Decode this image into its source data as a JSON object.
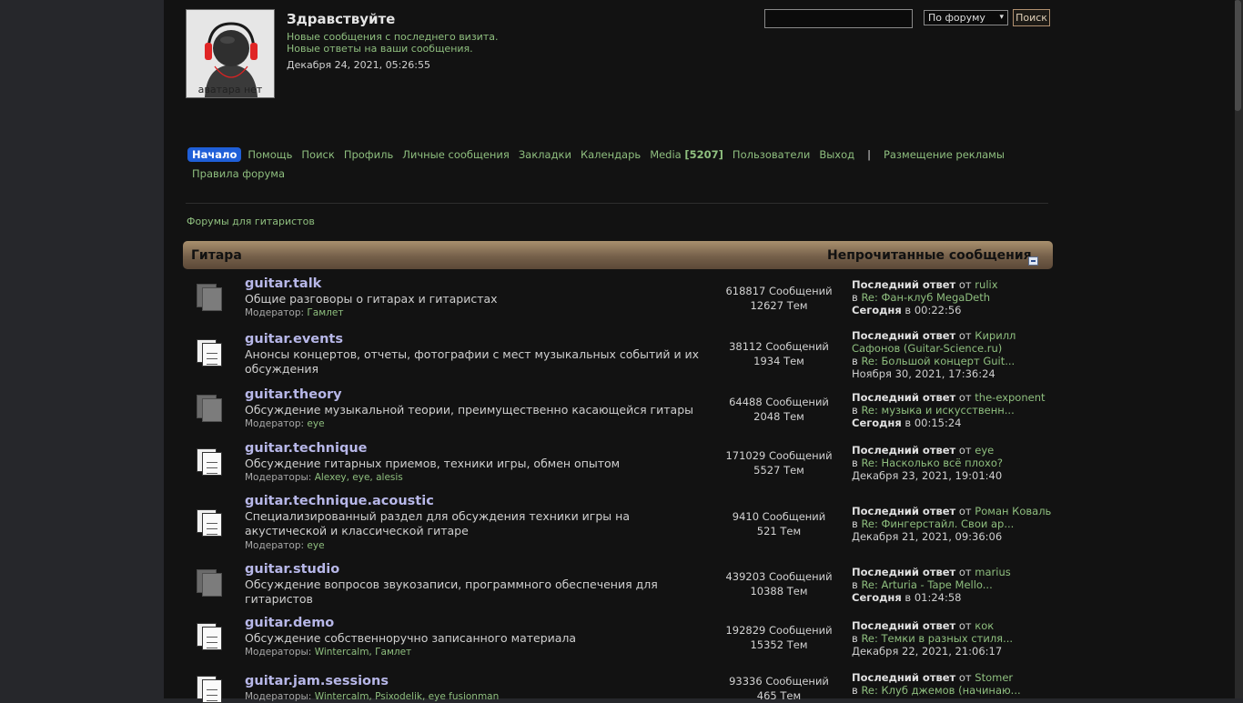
{
  "header": {
    "avatar_text": "аватара нет",
    "greeting": "Здравствуйте",
    "new_posts_link": "Новые сообщения с последнего визита.",
    "new_replies_link": "Новые ответы на ваши сообщения.",
    "datetime": "Декабря 24, 2021, 05:26:55"
  },
  "search": {
    "query": "",
    "scope": "По форуму",
    "button": "Поиск"
  },
  "nav": {
    "home": "Начало",
    "help": "Помощь",
    "search": "Поиск",
    "profile": "Профиль",
    "pm": "Личные сообщения",
    "bookmarks": "Закладки",
    "calendar": "Календарь",
    "media": "Media",
    "media_count": "[5207]",
    "members": "Пользователи",
    "logout": "Выход",
    "separator": "|",
    "ads": "Размещение рекламы",
    "rules": "Правила форума"
  },
  "breadcrumb": "Форумы для гитаристов",
  "category": {
    "title": "Гитара",
    "unread": "Непрочитанные сообщения"
  },
  "forums": [
    {
      "name": "guitar.talk",
      "desc": "Общие разговоры о гитарах и гитаристах",
      "mod_label": "Модератор:",
      "mods": "Гамлет",
      "posts": "618817 Сообщений",
      "topics": "12627 Тем",
      "last_label": "Последний ответ",
      "by": "от",
      "author": "rulix",
      "in": "в",
      "topic": "Re: Фан-клуб MegaDeth",
      "when": "Сегодня",
      "time": "в 00:22:56",
      "icon": "read"
    },
    {
      "name": "guitar.events",
      "desc": "Анонсы концертов, отчеты, фотографии с мест музыкальных событий и их обсуждения",
      "mod_label": "",
      "mods": "",
      "posts": "38112 Сообщений",
      "topics": "1934 Тем",
      "last_label": "Последний ответ",
      "by": "от",
      "author": "Кирилл Сафонов (Guitar-Science.ru)",
      "in": "в",
      "topic": "Re: Большой концерт Guit...",
      "when": "Ноября 30, 2021, 17:36:24",
      "time": "",
      "icon": "new"
    },
    {
      "name": "guitar.theory",
      "desc": "Обсуждение музыкальной теории, преимущественно касающейся гитары",
      "mod_label": "Модератор:",
      "mods": "eye",
      "posts": "64488 Сообщений",
      "topics": "2048 Тем",
      "last_label": "Последний ответ",
      "by": "от",
      "author": "the-exponent",
      "in": "в",
      "topic": "Re: музыка и искусственн...",
      "when": "Сегодня",
      "time": "в 00:15:24",
      "icon": "read"
    },
    {
      "name": "guitar.technique",
      "desc": "Обсуждение гитарных приемов, техники игры, обмен опытом",
      "mod_label": "Модераторы:",
      "mods": "Alexey, eye, alesis",
      "posts": "171029 Сообщений",
      "topics": "5527 Тем",
      "last_label": "Последний ответ",
      "by": "от",
      "author": "eye",
      "in": "в",
      "topic": "Re: Насколько всё плохо?",
      "when": "Декабря 23, 2021, 19:01:40",
      "time": "",
      "icon": "new"
    },
    {
      "name": "guitar.technique.acoustic",
      "desc": "Специализированный раздел для обсуждения техники игры на акустической и классической гитаре",
      "mod_label": "Модератор:",
      "mods": "eye",
      "posts": "9410 Сообщений",
      "topics": "521 Тем",
      "last_label": "Последний ответ",
      "by": "от",
      "author": "Роман Коваль",
      "in": "в",
      "topic": "Re: Фингерстайл. Свои ар...",
      "when": "Декабря 21, 2021, 09:36:06",
      "time": "",
      "icon": "new"
    },
    {
      "name": "guitar.studio",
      "desc": "Обсуждение вопросов звукозаписи, программного обеспечения для гитаристов",
      "mod_label": "",
      "mods": "",
      "posts": "439203 Сообщений",
      "topics": "10388 Тем",
      "last_label": "Последний ответ",
      "by": "от",
      "author": "marius",
      "in": "в",
      "topic": "Re: Arturia - Tape Mello...",
      "when": "Сегодня",
      "time": "в 01:24:58",
      "icon": "read"
    },
    {
      "name": "guitar.demo",
      "desc": "Обсуждение собственноручно записанного материала",
      "mod_label": "Модераторы:",
      "mods": "Wintercalm, Гамлет",
      "posts": "192829 Сообщений",
      "topics": "15352 Тем",
      "last_label": "Последний ответ",
      "by": "от",
      "author": "кок",
      "in": "в",
      "topic": "Re: Темки в разных стиля...",
      "when": "Декабря 22, 2021, 21:06:17",
      "time": "",
      "icon": "new"
    },
    {
      "name": "guitar.jam.sessions",
      "desc": "",
      "mod_label": "Модераторы:",
      "mods": "Wintercalm, Psixodelik, eye fusionman",
      "posts": "93336 Сообщений",
      "topics": "465 Тем",
      "last_label": "Последний ответ",
      "by": "от",
      "author": "Stomer",
      "in": "в",
      "topic": "Re: Клуб джемов (начинаю...",
      "when": "",
      "time": "",
      "icon": "new"
    }
  ]
}
